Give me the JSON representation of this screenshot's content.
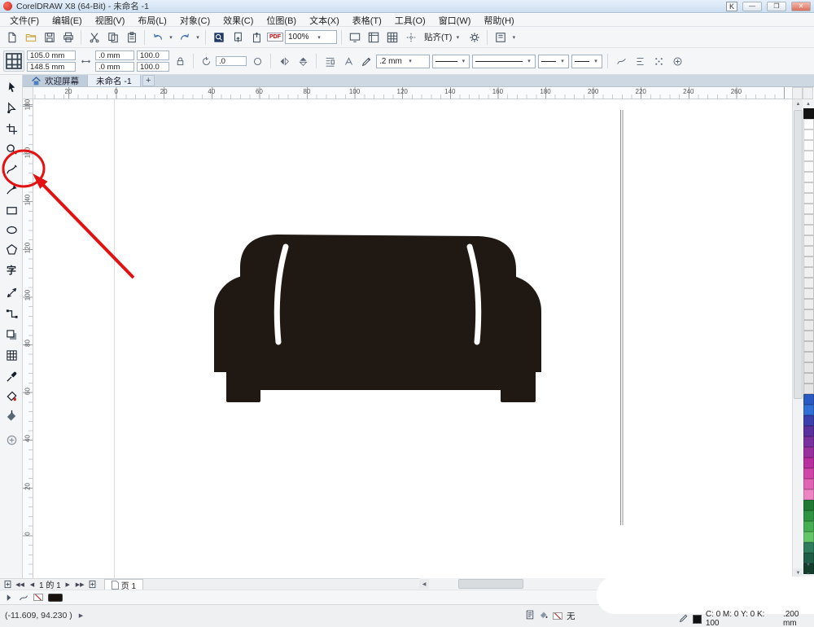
{
  "window": {
    "title": "CorelDRAW X8 (64-Bit) - 未命名 -1",
    "kbd_badge": "K"
  },
  "glyphs": {
    "caret": "▾",
    "up": "▲",
    "down": "▼",
    "left": "◀",
    "right": "▶",
    "prev2": "◀◀",
    "next2": "▶▶",
    "minimize": "—",
    "maximize": "❐",
    "close": "✕",
    "flyout": "«",
    "plus": "+"
  },
  "menu": {
    "items": [
      "文件(F)",
      "编辑(E)",
      "视图(V)",
      "布局(L)",
      "对象(C)",
      "效果(C)",
      "位图(B)",
      "文本(X)",
      "表格(T)",
      "工具(O)",
      "窗口(W)",
      "帮助(H)"
    ]
  },
  "toolbar": {
    "zoom_value": "100%",
    "pdf_label": "PDF",
    "snap_label": "贴齐(T)"
  },
  "property_bar": {
    "pos_x": "105.0 mm",
    "pos_y": "148.5 mm",
    "size_w": ".0 mm",
    "size_h": ".0 mm",
    "scale_x": "100.0",
    "scale_y": "100.0",
    "angle": ".0",
    "outline_width": ".2 mm"
  },
  "tabs": {
    "welcome": "欢迎屏幕",
    "document": "未命名 -1"
  },
  "rulers": {
    "horizontal": [
      "20",
      "0",
      "20",
      "40",
      "60",
      "80",
      "100",
      "120",
      "140",
      "160",
      "180",
      "200",
      "220",
      "240",
      "260"
    ],
    "vertical": [
      "180",
      "160",
      "140",
      "120",
      "100",
      "80",
      "60",
      "40",
      "20",
      "0"
    ]
  },
  "toolbox_tools": [
    "pick",
    "shape",
    "crop",
    "zoom",
    "freehand",
    "artistic-media",
    "rectangle",
    "ellipse",
    "polygon",
    "text",
    "parallel-dimension",
    "connector",
    "drop-shadow",
    "mesh-fill",
    "color-eyedropper",
    "smart-fill",
    "interactive-fill",
    "add-tools"
  ],
  "text_tool_glyph": "字",
  "pagebar": {
    "page_info": "1 的 1",
    "page_tab": "页 1"
  },
  "statusbar": {
    "cursor_pos": "(-11.609, 94.230 )",
    "fill_none": "无",
    "outline_color": "C: 0 M: 0 Y: 0 K: 100",
    "outline_width": ".200 mm"
  },
  "palette": {
    "swatches": [
      "#141414",
      "#fefefe",
      "#fdfdfd",
      "#fcfcfc",
      "#fbfbfb",
      "#fafafa",
      "#f9f9f9",
      "#f8f8f8",
      "#f7f7f7",
      "#f6f6f6",
      "#f5f5f5",
      "#f4f4f4",
      "#f3f3f3",
      "#f2f2f2",
      "#f1f1f1",
      "#f0f0f0",
      "#efefef",
      "#eeeeee",
      "#ededed",
      "#ececec",
      "#ebebeb",
      "#eaeaea",
      "#e9e9e9",
      "#e8e8e8",
      "#e7e7e7",
      "#e6e6e6",
      "#e5e5e5",
      "#2b59c3",
      "#2f6fd6",
      "#3b3fae",
      "#5a2f9e",
      "#7a2f9e",
      "#9a2f9e",
      "#b92fa0",
      "#d245a8",
      "#e262b4",
      "#ef84c4",
      "#1f7a33",
      "#2f9442",
      "#45ad52",
      "#63c468",
      "#2f7d5e",
      "#1f5f47",
      "#143f2f"
    ]
  },
  "annotation": {
    "color": "#e31212"
  },
  "artwork": {
    "fill": "#201812"
  }
}
